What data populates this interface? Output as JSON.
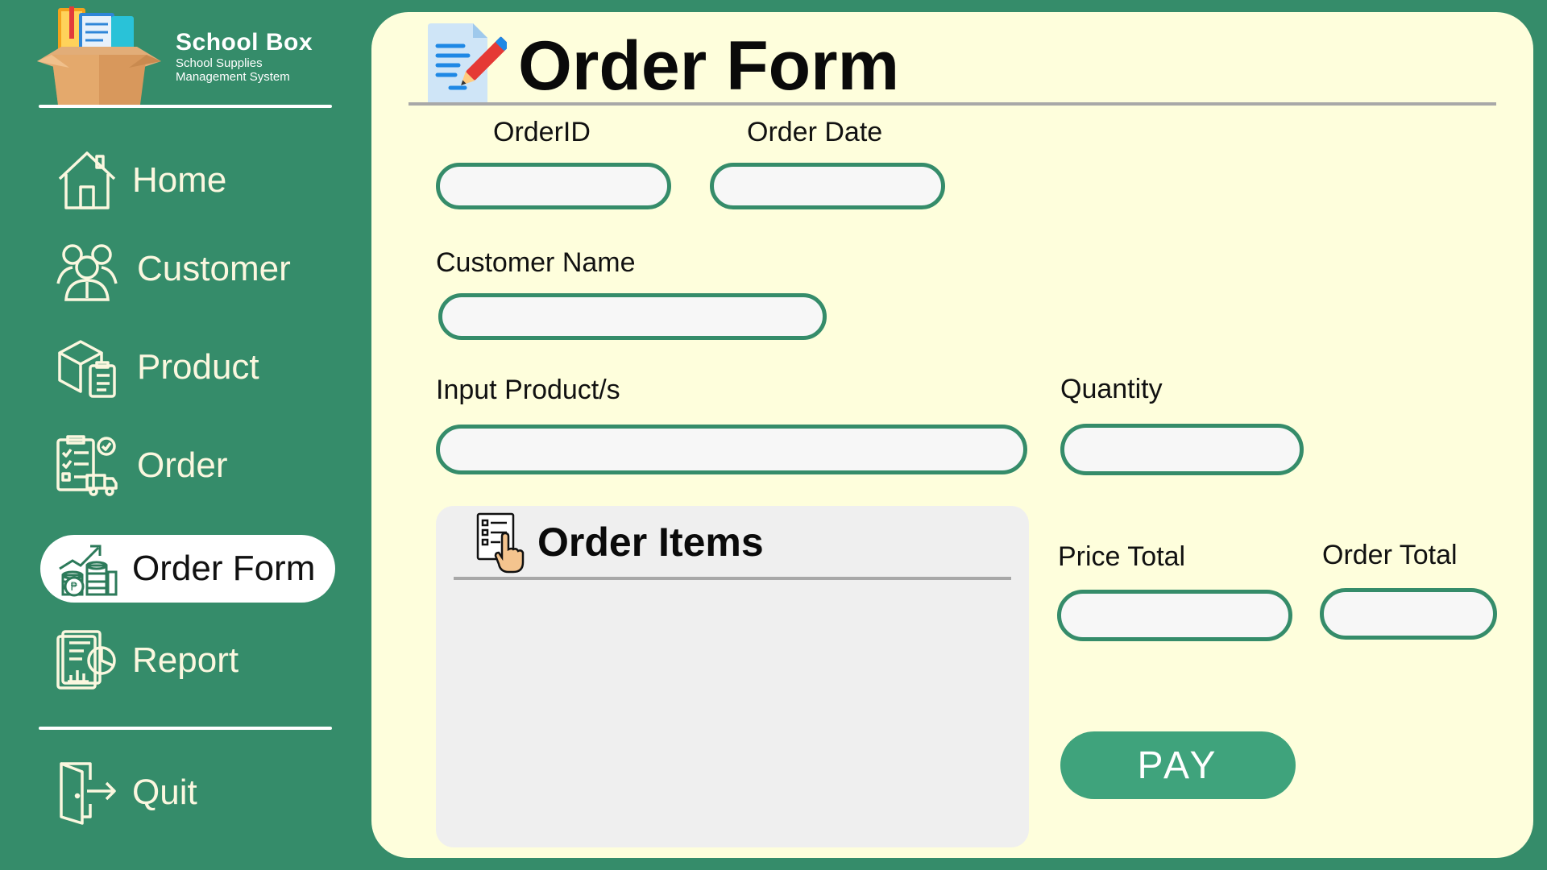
{
  "brand": {
    "name": "School Box",
    "subtitle_line1": "School Supplies",
    "subtitle_line2": "Management System"
  },
  "nav": {
    "items": [
      {
        "label": "Home",
        "icon": "home-icon",
        "active": false
      },
      {
        "label": "Customer",
        "icon": "customers-icon",
        "active": false
      },
      {
        "label": "Product",
        "icon": "product-box-icon",
        "active": false
      },
      {
        "label": "Order",
        "icon": "order-clipboard-icon",
        "active": false
      },
      {
        "label": "Order Form",
        "icon": "sales-growth-icon",
        "active": true
      },
      {
        "label": "Report",
        "icon": "report-chart-icon",
        "active": false
      }
    ],
    "quit": {
      "label": "Quit",
      "icon": "exit-door-icon"
    }
  },
  "main": {
    "title": "Order Form",
    "fields": {
      "order_id": {
        "label": "OrderID",
        "value": ""
      },
      "order_date": {
        "label": "Order Date",
        "value": ""
      },
      "customer_name": {
        "label": "Customer Name",
        "value": ""
      },
      "input_products": {
        "label": "Input Product/s",
        "value": ""
      },
      "quantity": {
        "label": "Quantity",
        "value": ""
      },
      "price_total": {
        "label": "Price Total",
        "value": ""
      },
      "order_total": {
        "label": "Order Total",
        "value": ""
      }
    },
    "order_items": {
      "title": "Order Items",
      "items": []
    },
    "pay_label": "PAY"
  },
  "colors": {
    "sidebar": "#358c6a",
    "panel": "#fefedc",
    "field_border": "#358c6a",
    "pay_button": "#3fa37c"
  }
}
